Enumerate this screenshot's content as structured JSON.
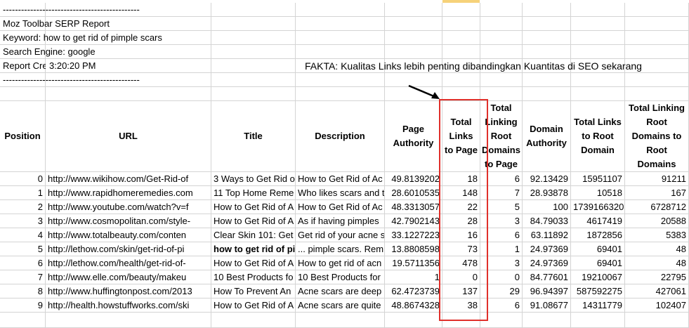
{
  "report_lines": [
    "---------------------------------------------",
    "Moz Toolbar SERP Report",
    "Keyword: how to get rid of pimple scars",
    "Search Engine: google",
    "Report Cre",
    "---------------------------------------------"
  ],
  "report_time": "3:20:20 PM",
  "fakta": "FAKTA: Kualitas Links lebih penting dibandingkan Kuantitas di SEO sekarang",
  "headers": [
    "Position",
    "URL",
    "Title",
    "Description",
    "Page Authority",
    "Total Links to Page",
    "Total Linking Root Domains to Page",
    "Domain Authority",
    "Total Links to Root Domain",
    "Total Linking Root Domains to Root Domains"
  ],
  "rows": [
    [
      "0",
      "http://www.wikihow.com/Get-Rid-of",
      "3 Ways to Get Rid o",
      "How to Get Rid of Ac",
      "49.8139202",
      "18",
      "6",
      "92.13429",
      "15951107",
      "91211"
    ],
    [
      "1",
      "http://www.rapidhomeremedies.com",
      "11 Top Home Reme",
      "Who likes scars and t",
      "28.6010535",
      "148",
      "7",
      "28.93878",
      "10518",
      "167"
    ],
    [
      "2",
      "http://www.youtube.com/watch?v=f",
      "How to Get Rid of A",
      "How to Get Rid of Ac",
      "48.3313057",
      "22",
      "5",
      "100",
      "1739166320",
      "6728712"
    ],
    [
      "3",
      "http://www.cosmopolitan.com/style-",
      "How to Get Rid of A",
      "As if having pimples",
      "42.7902143",
      "28",
      "3",
      "84.79033",
      "4617419",
      "20588"
    ],
    [
      "4",
      "http://www.totalbeauty.com/conten",
      "Clear Skin 101: Get",
      "Get rid of your acne s",
      "33.1227223",
      "16",
      "6",
      "63.11892",
      "1872856",
      "5383"
    ],
    [
      "5",
      "http://lethow.com/skin/get-rid-of-pi",
      "how to get rid of pi",
      "... pimple scars. Rem",
      "13.8808598",
      "73",
      "1",
      "24.97369",
      "69401",
      "48"
    ],
    [
      "6",
      "http://lethow.com/health/get-rid-of-",
      "How to Get Rid of A",
      "How to get rid of acn",
      "19.5711356",
      "478",
      "3",
      "24.97369",
      "69401",
      "48"
    ],
    [
      "7",
      "http://www.elle.com/beauty/makeu",
      "10 Best Products fo",
      "10 Best Products for",
      "1",
      "0",
      "0",
      "84.77601",
      "19210067",
      "22795"
    ],
    [
      "8",
      "http://www.huffingtonpost.com/2013",
      "How To Prevent An",
      "Acne scars are deep",
      "62.4723739",
      "137",
      "29",
      "96.94397",
      "587592275",
      "427061"
    ],
    [
      "9",
      "http://health.howstuffworks.com/ski",
      "How to Get Rid of A",
      "Acne scars are quite",
      "48.8674328",
      "38",
      "6",
      "91.08677",
      "14311779",
      "102407"
    ]
  ],
  "colors": {
    "highlight_box": "#e0302b",
    "gridline": "#d4d4d4",
    "selected_col_header": "#f6d27a"
  }
}
